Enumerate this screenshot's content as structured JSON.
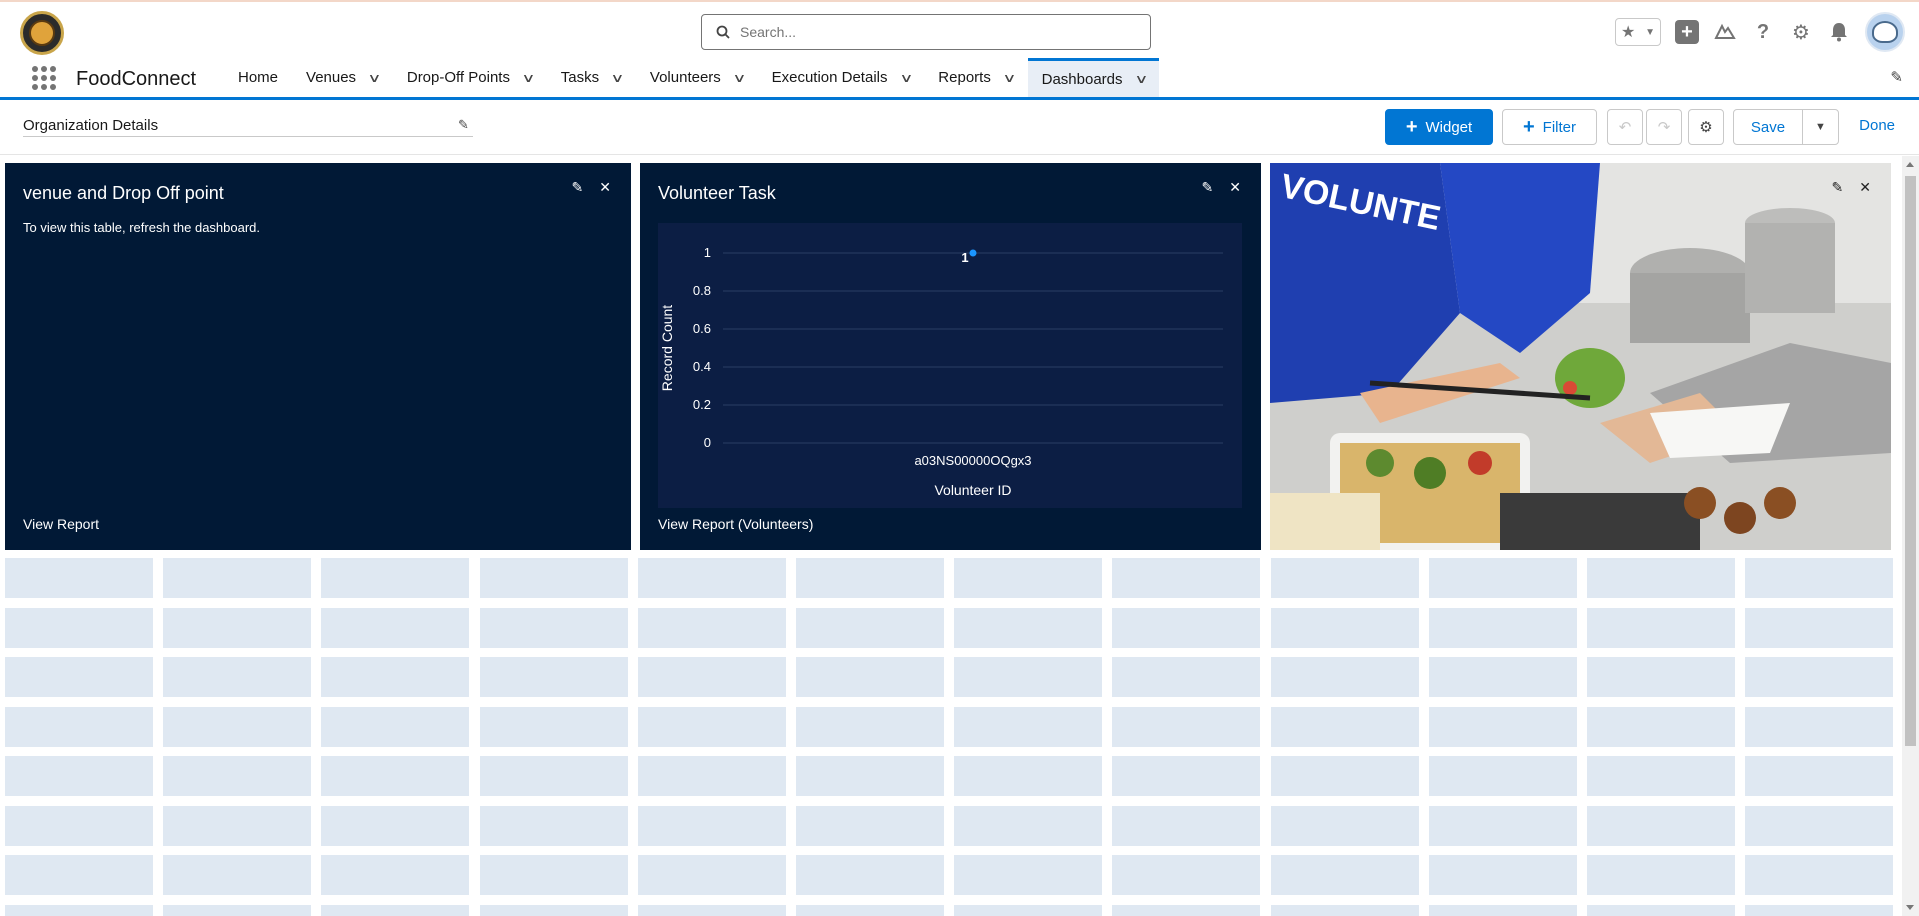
{
  "app": {
    "name": "FoodConnect",
    "search_placeholder": "Search..."
  },
  "nav": {
    "tabs": [
      {
        "label": "Home",
        "has_menu": false
      },
      {
        "label": "Venues",
        "has_menu": true
      },
      {
        "label": "Drop-Off Points",
        "has_menu": true
      },
      {
        "label": "Tasks",
        "has_menu": true
      },
      {
        "label": "Volunteers",
        "has_menu": true
      },
      {
        "label": "Execution Details",
        "has_menu": true
      },
      {
        "label": "Reports",
        "has_menu": true
      },
      {
        "label": "Dashboards",
        "has_menu": true,
        "active": true
      }
    ]
  },
  "dashboard": {
    "title": "Organization Details",
    "buttons": {
      "widget": "Widget",
      "filter": "Filter",
      "save": "Save",
      "done": "Done"
    }
  },
  "widgets": [
    {
      "title": "venue and Drop Off point",
      "message": "To view this table, refresh the dashboard.",
      "link": "View Report"
    },
    {
      "title": "Volunteer Task",
      "link": "View Report (Volunteers)"
    },
    {
      "title": "",
      "image": "volunteers-serving-food-photo"
    }
  ],
  "chart_data": {
    "type": "scatter",
    "title": "Volunteer Task",
    "xlabel": "Volunteer ID",
    "ylabel": "Record Count",
    "categories": [
      "a03NS00000OQgx3"
    ],
    "values": [
      1
    ],
    "data_labels": [
      "1"
    ],
    "yticks": [
      "0",
      "0.2",
      "0.4",
      "0.6",
      "0.8",
      "1"
    ],
    "ylim": [
      0,
      1
    ],
    "grid": true,
    "colors": {
      "point": "#1b96ff",
      "background": "#0c1e44",
      "grid": "#2a3d63"
    }
  },
  "colors": {
    "brand": "#0176d3",
    "widget_bg": "#011936",
    "grid_cell": "#dfe8f2"
  }
}
